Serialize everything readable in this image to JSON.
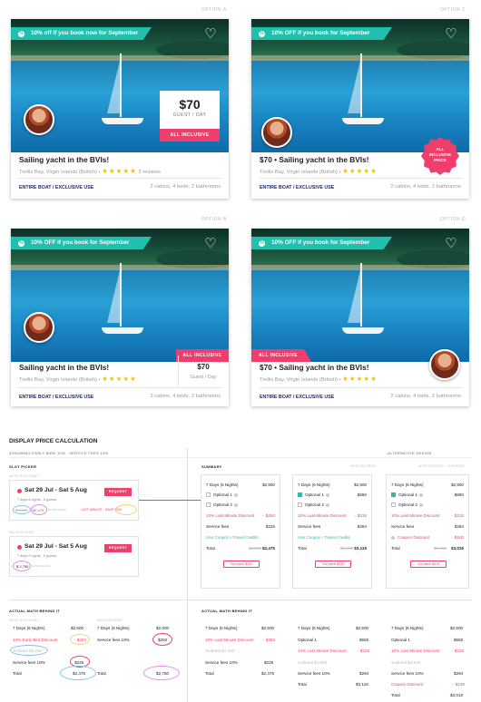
{
  "options": {
    "a": "OPTION A",
    "b": "OPTION B",
    "c": "OPTION C",
    "d": "OPTION D"
  },
  "listing": {
    "promo_now": "10% off if you book now for September",
    "promo": "10% OFF if you book for September",
    "price": "$70",
    "guest_day": "GUEST / DAY",
    "guest_day2": "Guest / Day",
    "all_inclusive": "ALL INCLUSIVE",
    "all_incl_price": [
      "ALL",
      "INCLUSIVE",
      "PRICE"
    ],
    "title": "Sailing yacht in the BVIs!",
    "title_c": "$70 • Sailing yacht in the BVIs!",
    "location": "Trellis Bay, Virgin Islands (British)",
    "stars": "★★★★★",
    "reviews": "3 reviews",
    "use": "ENTIRE BOAT / EXCLUSIVE USE",
    "specs": "2 cabins, 4 beds, 2 bathrooms"
  },
  "calc": {
    "heading": "DISPLAY PRICE CALCULATION",
    "assume": "ASSUMING EARLY BIRD 10% - SERVICE FEES 10%",
    "slot_picker": "SLOT PICKER",
    "with_discount": "WITH DISCOUNT",
    "no_discount": "NO DISCOUNT",
    "summary": "SUMMARY",
    "with_extras": "WITH EXTRAS",
    "alt_design": "ALTERNATIVE DESIGN",
    "with_extras_coupon": "WITH EXTRAS + COUPON",
    "slot1": {
      "date": "Sat 29 Jul - Sat 5 Aug",
      "button": "REQUEST",
      "sub": "7 days 6 nights - 5 guests",
      "old": "$ 2,750",
      "new": "$2,475",
      "strike": "$2,500 SAVED",
      "lastmin": "LAST MINUTE - SAVE $250"
    },
    "slot2": {
      "date": "Sat 29 Jul - Sat 5 Aug",
      "button": "REQUEST",
      "sub": "7 days 6 nights - 5 guests",
      "price": "$ 2,750",
      "strike": "$2,500 SAVED"
    },
    "sum1": {
      "nights": "7 Days (6 Nights)",
      "nights_v": "$2,500",
      "opt1": "Optional 1",
      "opt2": "Optional 2",
      "disc": "10% Last Minute Discount",
      "disc_v": "- $250",
      "fees": "Service fees",
      "fees_v": "$225",
      "coupon": "Use Coupon / Travel Credits",
      "total": "Total",
      "total_old": "$2,500",
      "total_v": "$2,475",
      "save": "You save $250"
    },
    "sum2": {
      "nights": "7 Days (6 Nights)",
      "nights_v": "$2,500",
      "opt1": "Optional 1",
      "opt1_v": "$650",
      "opt2": "Optional 2",
      "disc": "10% Last Minute Discount",
      "disc_v": "- $315",
      "fees": "Service fees",
      "fees_v": "$284",
      "coupon": "Use Coupon / Travel Credits",
      "total": "Total",
      "total_old": "$3,450",
      "total_v": "$3,119",
      "save": "You save $315"
    },
    "sum3": {
      "nights": "7 Days (6 Nights)",
      "nights_v": "$2,500",
      "opt1": "Optional 1",
      "opt1_v": "$650",
      "opt2": "Optional 2",
      "disc": "10% Last Minute Discount",
      "disc_v": "- $315",
      "fees": "Service fees",
      "fees_v": "$284",
      "coupon": "Coupon Discount",
      "coupon_v": "- $100",
      "total": "Total",
      "total_old": "$3,450",
      "total_v": "$3,019",
      "save": "You save $415"
    },
    "math_heading": "ACTUAL MATH BEHIND IT",
    "m1": {
      "nights": "7 Days (6 Nights)",
      "nights_v": "$2,500",
      "disc": "10% Early Bird Discount",
      "disc_v": "- $250",
      "sub": "Subtotal $2,250",
      "fees": "Service fees 10%",
      "fees_v": "$225",
      "total": "Total",
      "total_v": "$2,475"
    },
    "m2": {
      "nights": "7 Days (6 Nights)",
      "nights_v": "$2,500",
      "fees": "Service fees 10%",
      "fees_v": "$250",
      "total": "Total",
      "total_v": "$2,750"
    },
    "m3": {
      "nights": "7 Days (6 Nights)",
      "nights_v": "$2,500",
      "disc": "10% Last Minute Discount",
      "disc_v": "- $250",
      "sub": "Subtotal $2,250",
      "fees": "Service fees 10%",
      "fees_v": "$225",
      "total": "Total",
      "total_v": "$2,475"
    },
    "m4": {
      "nights": "7 Days (6 Nights)",
      "nights_v": "$2,500",
      "opt1": "Optional 1",
      "opt1_v": "$650",
      "disc": "10% Last Minute Discount",
      "disc_v": "- $315",
      "sub": "Subtotal $2,835",
      "fees": "Service fees 10%",
      "fees_v": "$284",
      "total": "Total",
      "total_v": "$3,119"
    },
    "m5": {
      "nights": "7 Days (6 Nights)",
      "nights_v": "$2,500",
      "opt1": "Optional 1",
      "opt1_v": "$650",
      "disc": "10% Last Minute Discount",
      "disc_v": "- $315",
      "sub": "Subtotal $2,835",
      "fees": "Service fees 10%",
      "fees_v": "$284",
      "coupon": "Coupon Discount",
      "coupon_v": "- $100",
      "total": "Total",
      "total_v": "$3,019"
    }
  },
  "colors": {
    "teal": "#20bfae",
    "pink": "#ef3e6b",
    "navy": "#1f2a6b",
    "star": "#f2c100"
  },
  "icons": [
    "heart-icon",
    "tag-icon",
    "star-icon",
    "info-icon",
    "checkbox-icon",
    "calendar-dot-icon"
  ]
}
